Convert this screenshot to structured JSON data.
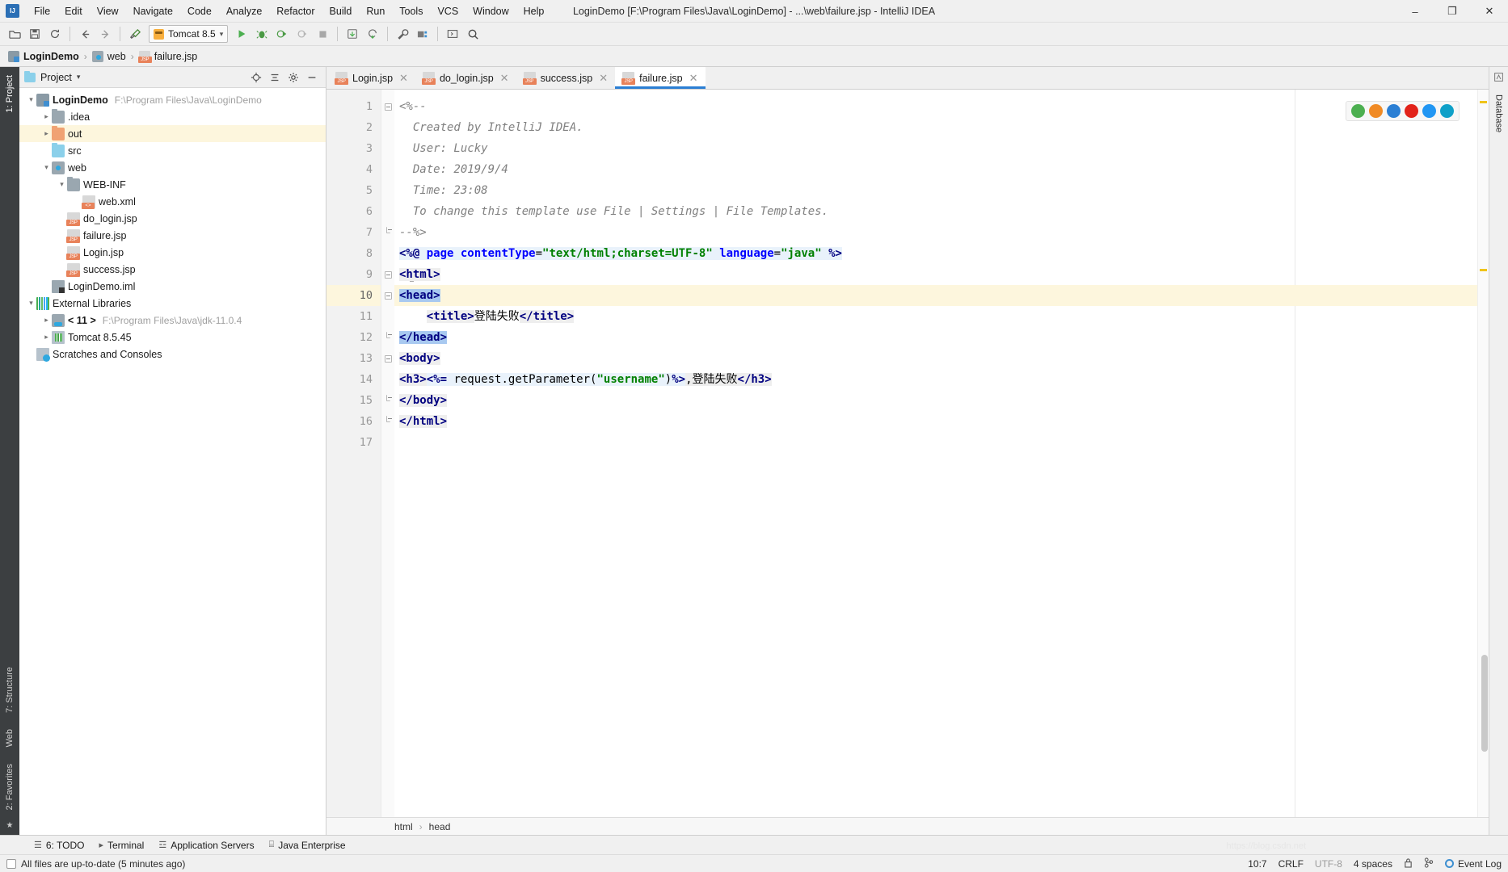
{
  "window": {
    "title": "LoginDemo [F:\\Program Files\\Java\\LoginDemo] - ...\\web\\failure.jsp - IntelliJ IDEA",
    "minimize": "–",
    "maximize": "❐",
    "close": "✕"
  },
  "menu": [
    {
      "label": "File"
    },
    {
      "label": "Edit"
    },
    {
      "label": "View"
    },
    {
      "label": "Navigate"
    },
    {
      "label": "Code"
    },
    {
      "label": "Analyze"
    },
    {
      "label": "Refactor"
    },
    {
      "label": "Build"
    },
    {
      "label": "Run"
    },
    {
      "label": "Tools"
    },
    {
      "label": "VCS"
    },
    {
      "label": "Window"
    },
    {
      "label": "Help"
    }
  ],
  "toolbar": {
    "open_icon": "open-folder-icon",
    "save_icon": "save-icon",
    "sync_icon": "sync-icon",
    "back_icon": "back-arrow-icon",
    "forward_icon": "forward-arrow-icon",
    "build_icon": "hammer-icon",
    "run_config": "Tomcat 8.5",
    "run_icon": "run-icon",
    "debug_icon": "debug-icon",
    "coverage_icon": "run-with-coverage-icon",
    "profile_icon": "profile-icon",
    "stop_icon": "stop-icon",
    "update_icon": "update-app-icon",
    "rerun_icon": "rerun-icon",
    "settings_icon": "wrench-icon",
    "project_struct_icon": "project-structure-icon",
    "console_icon": "console-icon",
    "search_icon": "search-icon"
  },
  "breadcrumb": [
    {
      "label": "LoginDemo",
      "icon": "module-icon",
      "bold": true
    },
    {
      "label": "web",
      "icon": "web-folder-icon",
      "bold": false
    },
    {
      "label": "failure.jsp",
      "icon": "jsp-file-icon",
      "bold": false
    }
  ],
  "left_strip": {
    "project_tab": "1: Project",
    "structure_tab": "7: Structure",
    "web_tab": "Web",
    "favorites_tab": "2: Favorites",
    "star_icon": "star-icon"
  },
  "right_strip": {
    "database_tab": "Database",
    "maven_icon": "maven-icon"
  },
  "project_panel": {
    "title": "Project",
    "dropdown_icon": "chevron-down-icon",
    "locate_icon": "locate-target-icon",
    "collapse_icon": "collapse-all-icon",
    "settings_icon": "gear-icon",
    "hide_icon": "hide-icon",
    "tree": [
      {
        "label": "LoginDemo",
        "path": "F:\\Program Files\\Java\\LoginDemo",
        "indent": 0,
        "arrow": "v",
        "icon": "ic-module",
        "bold": true,
        "highlight": false
      },
      {
        "label": ".idea",
        "path": "",
        "indent": 1,
        "arrow": ">",
        "icon": "ic-folder",
        "bold": false,
        "highlight": false
      },
      {
        "label": "out",
        "path": "",
        "indent": 1,
        "arrow": ">",
        "icon": "ic-folder-orange",
        "bold": false,
        "highlight": true
      },
      {
        "label": "src",
        "path": "",
        "indent": 1,
        "arrow": "",
        "icon": "ic-folder-blue",
        "bold": false,
        "highlight": false
      },
      {
        "label": "web",
        "path": "",
        "indent": 1,
        "arrow": "v",
        "icon": "ic-web",
        "bold": false,
        "highlight": false
      },
      {
        "label": "WEB-INF",
        "path": "",
        "indent": 2,
        "arrow": "v",
        "icon": "ic-folder",
        "bold": false,
        "highlight": false
      },
      {
        "label": "web.xml",
        "path": "",
        "indent": 3,
        "arrow": "",
        "icon": "ic-xml",
        "bold": false,
        "highlight": false
      },
      {
        "label": "do_login.jsp",
        "path": "",
        "indent": 2,
        "arrow": "",
        "icon": "ic-jsp",
        "bold": false,
        "highlight": false
      },
      {
        "label": "failure.jsp",
        "path": "",
        "indent": 2,
        "arrow": "",
        "icon": "ic-jsp",
        "bold": false,
        "highlight": false
      },
      {
        "label": "Login.jsp",
        "path": "",
        "indent": 2,
        "arrow": "",
        "icon": "ic-jsp",
        "bold": false,
        "highlight": false
      },
      {
        "label": "success.jsp",
        "path": "",
        "indent": 2,
        "arrow": "",
        "icon": "ic-jsp",
        "bold": false,
        "highlight": false
      },
      {
        "label": "LoginDemo.iml",
        "path": "",
        "indent": 1,
        "arrow": "",
        "icon": "ic-iml",
        "bold": false,
        "highlight": false
      },
      {
        "label": "External Libraries",
        "path": "",
        "indent": 0,
        "arrow": "v",
        "icon": "ic-lib",
        "bold": false,
        "highlight": false
      },
      {
        "label": "< 11 >",
        "path": "F:\\Program Files\\Java\\jdk-11.0.4",
        "indent": 1,
        "arrow": ">",
        "icon": "ic-jdk",
        "bold": true,
        "highlight": false
      },
      {
        "label": "Tomcat 8.5.45",
        "path": "",
        "indent": 1,
        "arrow": ">",
        "icon": "ic-tomcat",
        "bold": false,
        "highlight": false
      },
      {
        "label": "Scratches and Consoles",
        "path": "",
        "indent": 0,
        "arrow": "",
        "icon": "ic-scratch",
        "bold": false,
        "highlight": false
      }
    ]
  },
  "editor": {
    "tabs": [
      {
        "label": "Login.jsp",
        "active": false,
        "close": "✕"
      },
      {
        "label": "do_login.jsp",
        "active": false,
        "close": "✕"
      },
      {
        "label": "success.jsp",
        "active": false,
        "close": "✕"
      },
      {
        "label": "failure.jsp",
        "active": true,
        "close": "✕"
      }
    ],
    "line_numbers": [
      "1",
      "2",
      "3",
      "4",
      "5",
      "6",
      "7",
      "8",
      "9",
      "10",
      "11",
      "12",
      "13",
      "14",
      "15",
      "16",
      "17"
    ],
    "current_line": 10,
    "lines": [
      {
        "n": 1,
        "tokens": [
          {
            "t": "<%--",
            "c": "cmt"
          }
        ]
      },
      {
        "n": 2,
        "tokens": [
          {
            "t": "  Created by IntelliJ IDEA.",
            "c": "cmt"
          }
        ]
      },
      {
        "n": 3,
        "tokens": [
          {
            "t": "  User: Lucky",
            "c": "cmt"
          }
        ]
      },
      {
        "n": 4,
        "tokens": [
          {
            "t": "  Date: 2019/9/4",
            "c": "cmt"
          }
        ]
      },
      {
        "n": 5,
        "tokens": [
          {
            "t": "  Time: 23:08",
            "c": "cmt"
          }
        ]
      },
      {
        "n": 6,
        "tokens": [
          {
            "t": "  To change this template use File | Settings | File Templates.",
            "c": "cmt"
          }
        ]
      },
      {
        "n": 7,
        "tokens": [
          {
            "t": "--%>",
            "c": "cmt"
          }
        ]
      },
      {
        "n": 8,
        "tokens": [
          {
            "t": "<%@ ",
            "c": "kw dir-bg"
          },
          {
            "t": "page ",
            "c": "attr dir-bg"
          },
          {
            "t": "contentType",
            "c": "attr dir-bg"
          },
          {
            "t": "=",
            "c": "plain dir-bg"
          },
          {
            "t": "\"text/html;charset=UTF-8\" ",
            "c": "str dir-bg"
          },
          {
            "t": "language",
            "c": "attr dir-bg"
          },
          {
            "t": "=",
            "c": "plain dir-bg"
          },
          {
            "t": "\"java\" ",
            "c": "str dir-bg"
          },
          {
            "t": "%>",
            "c": "kw dir-bg"
          }
        ]
      },
      {
        "n": 9,
        "tokens": [
          {
            "t": "<html>",
            "c": "tag tag-bg"
          }
        ]
      },
      {
        "n": 10,
        "tokens": [
          {
            "t": "<head>",
            "c": "tag match"
          }
        ]
      },
      {
        "n": 11,
        "tokens": [
          {
            "t": "    ",
            "c": "plain"
          },
          {
            "t": "<title>",
            "c": "tag tag-bg"
          },
          {
            "t": "登陆失败",
            "c": "txt"
          },
          {
            "t": "</title>",
            "c": "tag tag-bg"
          }
        ]
      },
      {
        "n": 12,
        "tokens": [
          {
            "t": "</head>",
            "c": "tag match"
          }
        ]
      },
      {
        "n": 13,
        "tokens": [
          {
            "t": "<body>",
            "c": "tag tag-bg"
          }
        ]
      },
      {
        "n": 14,
        "tokens": [
          {
            "t": "<h3>",
            "c": "tag tag-bg"
          },
          {
            "t": "<%= ",
            "c": "kw scriptlet"
          },
          {
            "t": "request",
            "c": "plain scriptlet"
          },
          {
            "t": ".",
            "c": "plain scriptlet"
          },
          {
            "t": "getParameter",
            "c": "plain scriptlet"
          },
          {
            "t": "(",
            "c": "plain scriptlet"
          },
          {
            "t": "\"username\"",
            "c": "str scriptlet"
          },
          {
            "t": ")",
            "c": "plain scriptlet"
          },
          {
            "t": "%>",
            "c": "kw scriptlet"
          },
          {
            "t": ",",
            "c": "txt tag-bg"
          },
          {
            "t": "登陆失败",
            "c": "txt tag-bg"
          },
          {
            "t": "</h3>",
            "c": "tag tag-bg"
          }
        ]
      },
      {
        "n": 15,
        "tokens": [
          {
            "t": "</body>",
            "c": "tag tag-bg"
          }
        ]
      },
      {
        "n": 16,
        "tokens": [
          {
            "t": "</html>",
            "c": "tag tag-bg"
          }
        ]
      },
      {
        "n": 17,
        "tokens": [
          {
            "t": "",
            "c": "plain"
          }
        ]
      }
    ],
    "breadcrumb": [
      "html",
      "head"
    ],
    "breadcrumb_sep": "›",
    "browsers": [
      {
        "name": "chrome-icon",
        "color": "#4caf50"
      },
      {
        "name": "firefox-icon",
        "color": "#f08a24"
      },
      {
        "name": "edge-icon",
        "color": "#2b7fd4"
      },
      {
        "name": "opera-icon",
        "color": "#e2231a"
      },
      {
        "name": "ie-icon",
        "color": "#2196f3"
      },
      {
        "name": "safari-icon",
        "color": "#0fa0c8"
      }
    ]
  },
  "bottom_tools": [
    {
      "label": "6: TODO",
      "icon": "todo-icon"
    },
    {
      "label": "Terminal",
      "icon": "terminal-icon"
    },
    {
      "label": "Application Servers",
      "icon": "server-icon"
    },
    {
      "label": "Java Enterprise",
      "icon": "javaee-icon"
    }
  ],
  "statusbar": {
    "message": "All files are up-to-date (5 minutes ago)",
    "caret": "10:7",
    "line_sep": "CRLF",
    "encoding": "UTF-8",
    "indent": "4 spaces",
    "lock_icon": "lock-icon",
    "branch_icon": "git-branch-icon",
    "event_log": "Event Log",
    "event_log_icon": "event-log-icon"
  },
  "colors": {
    "accent": "#2b7fd4",
    "highlight_row": "#fdf6dd",
    "match_brace": "#a8c9f0",
    "directive_bg": "#e9f2fb",
    "tag_bg": "#eeeeee",
    "keyword": "#000080",
    "attribute": "#0000ff",
    "string": "#008000",
    "comment": "#808080"
  }
}
